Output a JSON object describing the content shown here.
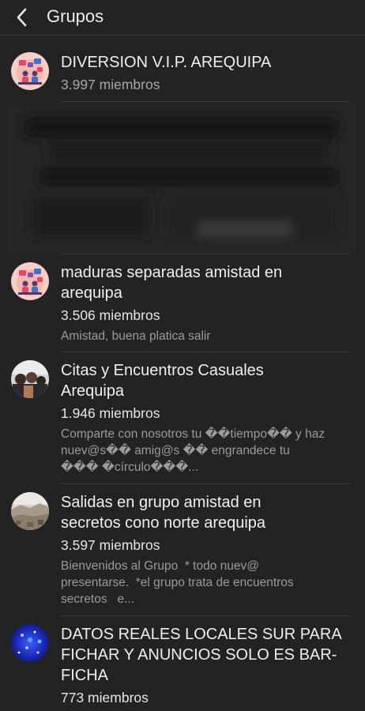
{
  "header": {
    "back_icon": "chevron-left-icon",
    "title": "Grupos"
  },
  "groups": [
    {
      "name": "DIVERSION V.I.P. AREQUIPA",
      "members": "3.997 miembros",
      "description": "",
      "avatar_icon": "group-illustration-avatar"
    },
    {
      "name": "maduras separadas amistad en arequipa",
      "members": "3.506 miembros",
      "description": "Amistad, buena platica salir",
      "avatar_icon": "group-illustration-avatar"
    },
    {
      "name": "Citas y Encuentros Casuales Arequipa",
      "members": "1.946 miembros",
      "description": "Comparte con nosotros tu ��tiempo�� y haz nuev@s�� amig@s �� engrandece tu ��� �círculo���...",
      "avatar_icon": "group-photo-avatar"
    },
    {
      "name": "Salidas en grupo amistad en secretos cono norte arequipa",
      "members": "3.597 miembros",
      "description": "Bienvenidos al Grupo  * todo nuev@ presentarse.  *el grupo trata de encuentros secretos   e...",
      "avatar_icon": "landscape-photo-avatar"
    },
    {
      "name": "DATOS REALES LOCALES SUR PARA FICHAR Y ANUNCIOS SOLO ES BAR-FICHA",
      "members": "773 miembros",
      "description": "",
      "avatar_icon": "blue-lights-avatar"
    }
  ],
  "colors": {
    "background": "#232324",
    "text_primary": "#efefef",
    "text_secondary": "#9b9b9b",
    "divider": "#3c3c3e"
  }
}
